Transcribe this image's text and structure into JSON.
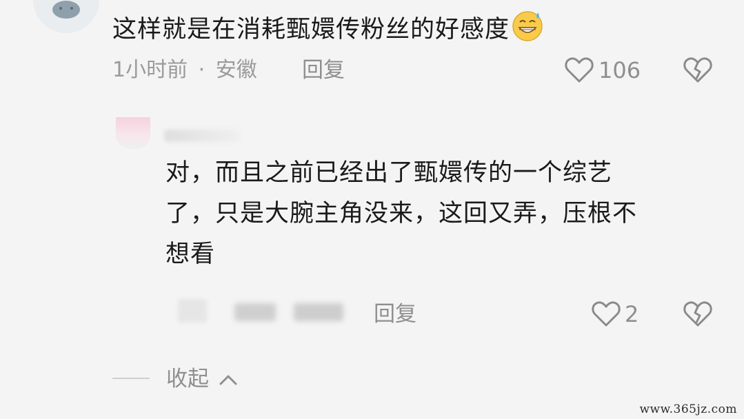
{
  "top_comment": {
    "text": "这样就是在消耗甄嬛传粉丝的好感度",
    "emoji_icon": "grinning-sweat-emoji",
    "time": "1小时前",
    "separator": "·",
    "location": "安徽",
    "reply_label": "回复",
    "like_icon": "heart-outline-icon",
    "like_count": "106",
    "dislike_icon": "broken-heart-icon"
  },
  "reply_comment": {
    "lines": [
      "对，而且之前已经出了甄嬛传的一个综艺",
      "了，只是大腕主角没来，这回又弄，压根不",
      "想看"
    ],
    "reply_label": "回复",
    "like_icon": "heart-outline-icon",
    "like_count": "2",
    "dislike_icon": "broken-heart-icon"
  },
  "collapse": {
    "label": "收起",
    "icon": "chevron-up-icon"
  },
  "watermark": "www.365jz.com",
  "colors": {
    "background": "#f4f4f4",
    "text_primary": "#1a1a1a",
    "text_secondary": "#8f8f8f"
  }
}
